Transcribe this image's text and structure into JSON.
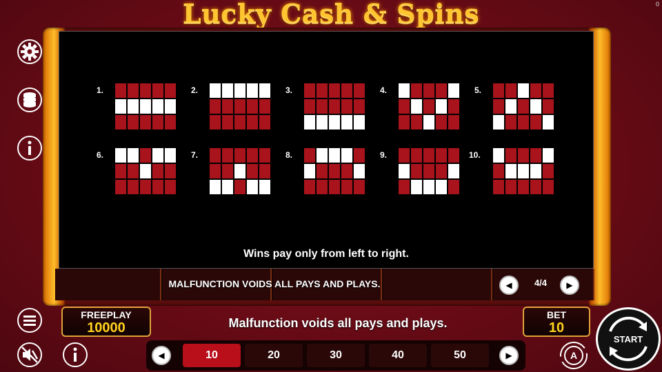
{
  "header": {
    "title": "Lucky Cash & Spins",
    "corner_counter": "0"
  },
  "paytable": {
    "lines": [
      {
        "label": "1.",
        "pattern": [
          [
            0,
            0,
            0,
            0,
            0
          ],
          [
            1,
            1,
            1,
            1,
            1
          ],
          [
            0,
            0,
            0,
            0,
            0
          ]
        ]
      },
      {
        "label": "2.",
        "pattern": [
          [
            1,
            1,
            1,
            1,
            1
          ],
          [
            0,
            0,
            0,
            0,
            0
          ],
          [
            0,
            0,
            0,
            0,
            0
          ]
        ]
      },
      {
        "label": "3.",
        "pattern": [
          [
            0,
            0,
            0,
            0,
            0
          ],
          [
            0,
            0,
            0,
            0,
            0
          ],
          [
            1,
            1,
            1,
            1,
            1
          ]
        ]
      },
      {
        "label": "4.",
        "pattern": [
          [
            1,
            0,
            0,
            0,
            1
          ],
          [
            0,
            1,
            0,
            1,
            0
          ],
          [
            0,
            0,
            1,
            0,
            0
          ]
        ]
      },
      {
        "label": "5.",
        "pattern": [
          [
            0,
            0,
            1,
            0,
            0
          ],
          [
            0,
            1,
            0,
            1,
            0
          ],
          [
            1,
            0,
            0,
            0,
            1
          ]
        ]
      },
      {
        "label": "6.",
        "pattern": [
          [
            1,
            1,
            0,
            1,
            1
          ],
          [
            0,
            0,
            1,
            0,
            0
          ],
          [
            0,
            0,
            0,
            0,
            0
          ]
        ]
      },
      {
        "label": "7.",
        "pattern": [
          [
            0,
            0,
            0,
            0,
            0
          ],
          [
            0,
            0,
            1,
            0,
            0
          ],
          [
            1,
            1,
            0,
            1,
            1
          ]
        ]
      },
      {
        "label": "8.",
        "pattern": [
          [
            0,
            1,
            1,
            1,
            0
          ],
          [
            1,
            0,
            0,
            0,
            1
          ],
          [
            0,
            0,
            0,
            0,
            0
          ]
        ]
      },
      {
        "label": "9.",
        "pattern": [
          [
            0,
            0,
            0,
            0,
            0
          ],
          [
            1,
            0,
            0,
            0,
            1
          ],
          [
            0,
            1,
            1,
            1,
            0
          ]
        ]
      },
      {
        "label": "10.",
        "pattern": [
          [
            1,
            0,
            0,
            0,
            1
          ],
          [
            0,
            1,
            1,
            1,
            0
          ],
          [
            0,
            0,
            0,
            0,
            0
          ]
        ]
      }
    ],
    "wins_note": "Wins pay only from left to right.",
    "footer_note": "MALFUNCTION VOIDS ALL PAYS AND PLAYS.",
    "page_indicator": "4/4"
  },
  "status_bar": {
    "message": "Malfunction voids all pays and plays.",
    "freeplay": {
      "label": "FREEPLAY",
      "value": "10000"
    },
    "bet": {
      "label": "BET",
      "value": "10"
    }
  },
  "bet_options": [
    "10",
    "20",
    "30",
    "40",
    "50"
  ],
  "selected_bet": "10",
  "controls": {
    "start_label": "START",
    "auto_label": "A"
  },
  "colors": {
    "line_off": "#a9141c",
    "line_on": "#ffffff",
    "title_gold": "#ffc531",
    "value_yellow": "#ffd21f"
  }
}
